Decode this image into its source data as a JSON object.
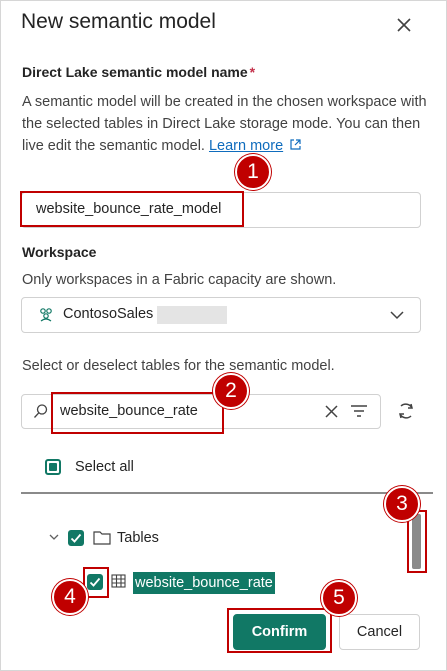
{
  "dialog": {
    "title": "New semantic model",
    "close_icon": "close-icon"
  },
  "name_section": {
    "label": "Direct Lake semantic model name",
    "required_mark": "*",
    "description": "A semantic model will be created in the chosen workspace with the selected tables in Direct Lake storage mode. You can then live edit the semantic model.",
    "learn_more_label": "Learn more",
    "value": "website_bounce_rate_model"
  },
  "workspace_section": {
    "label": "Workspace",
    "hint": "Only workspaces in a Fabric capacity are shown.",
    "selected": "ContosoSales"
  },
  "tables_section": {
    "instruction": "Select or deselect tables for the semantic model.",
    "search_value": "website_bounce_rate",
    "select_all_label": "Select all",
    "tree": {
      "folder_label": "Tables",
      "table_label": "website_bounce_rate"
    }
  },
  "footer": {
    "confirm_label": "Confirm",
    "cancel_label": "Cancel"
  },
  "callouts": [
    "1",
    "2",
    "3",
    "4",
    "5"
  ],
  "colors": {
    "accent": "#117865",
    "callout": "#c00000",
    "link": "#0f6cbd"
  }
}
